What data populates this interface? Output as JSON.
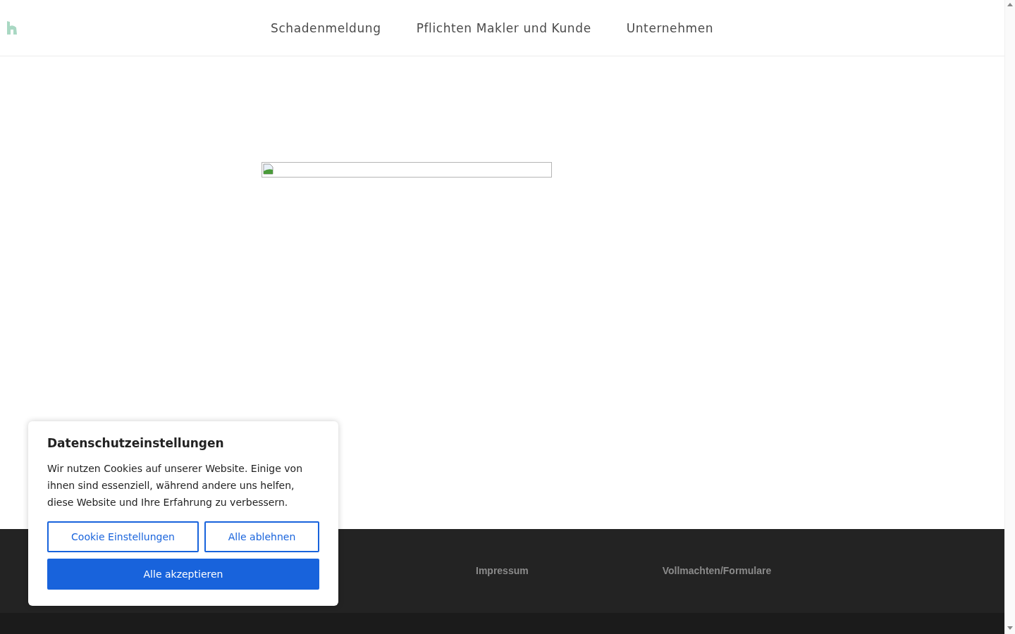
{
  "nav": [
    "Schadenmeldung",
    "Pflichten Makler und Kunde",
    "Unternehmen"
  ],
  "footer_links": [
    "Impressum",
    "Vollmachten/Formulare"
  ],
  "cookie_dialog": {
    "title": "Datenschutzeinstellungen",
    "text": "Wir nutzen Cookies auf unserer Website. Einige von ihnen sind essenziell, während andere uns helfen, diese Website und Ihre Erfahrung zu verbessern.",
    "buttons": [
      {
        "label": "Cookie Einstellungen",
        "kind": "outline"
      },
      {
        "label": "Alle ablehnen",
        "kind": "outline"
      },
      {
        "label": "Alle akzeptieren",
        "kind": "primary"
      }
    ]
  }
}
